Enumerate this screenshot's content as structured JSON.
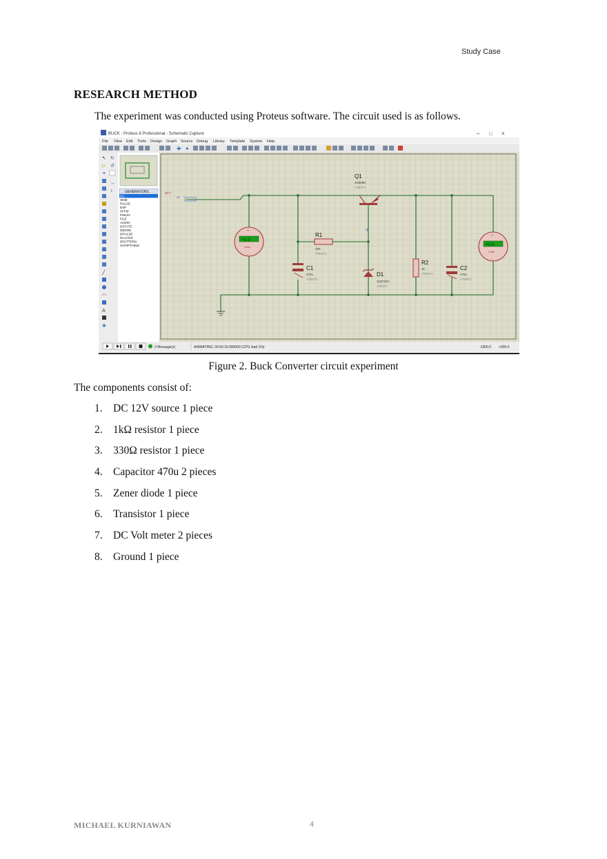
{
  "header": {
    "running_title": "Study Case"
  },
  "section": {
    "heading": "RESEARCH METHOD",
    "intro": "The experiment was conducted using Proteus software. The circuit used is as follows."
  },
  "figure": {
    "caption": "Figure 2. Buck Converter circuit experiment",
    "screenshot": {
      "window_title": "BUCK - Proteus 8 Professional - Schematic Capture",
      "menu": [
        "File",
        "View",
        "Edit",
        "Tools",
        "Design",
        "Graph",
        "Source",
        "Debug",
        "Library",
        "Template",
        "System",
        "Help"
      ],
      "panel_title": "GENERATORS",
      "generators": [
        "DC",
        "SINE",
        "PULSE",
        "EXP",
        "SFFM",
        "PWLIN",
        "FILE",
        "AUDIO",
        "DSTATE",
        "DEDGE",
        "DPULSE",
        "DCLOCK",
        "DPATTERN",
        "SCRIPTABLE"
      ],
      "status_messages": "2 Message(s)",
      "status_animation": "ANIMATING: 00:00:19.900000 (CPU load 1%)",
      "status_coords": [
        "-1900.0",
        "+900.0"
      ],
      "components": {
        "q1": {
          "name": "Q1",
          "part": "2N3055",
          "text": "<TEXT>"
        },
        "r1": {
          "name": "R1",
          "value": "330",
          "text": "<TEXT>"
        },
        "c1": {
          "name": "C1",
          "value": "470u",
          "text": "<TEXT>"
        },
        "d1": {
          "name": "D1",
          "part": "1N4733A",
          "text": "<TEXT>"
        },
        "r2": {
          "name": "R2",
          "value": "1k",
          "text": "<TEXT>"
        },
        "c2": {
          "name": "C2",
          "value": "470u",
          "text": "<TEXT>"
        },
        "source": {
          "label": "DC?",
          "value": "12V"
        },
        "volt1": {
          "reading": "+12.0",
          "unit": "Volts"
        },
        "volt2": {
          "reading": "+5.41",
          "unit": "Volts"
        }
      }
    }
  },
  "components": {
    "heading": "The components consist of:",
    "items": [
      "DC 12V source 1 piece",
      "1kΩ resistor 1 piece",
      "330Ω resistor 1 piece",
      "Capacitor 470u 2 pieces",
      "Zener diode 1 piece",
      "Transistor 1 piece",
      "DC Volt meter 2 pieces",
      "Ground 1 piece"
    ]
  },
  "footer": {
    "author": "MICHAEL KURNIAWAN",
    "page_number": "4"
  },
  "colors": {
    "schematic_bg": "#dcdcc8",
    "wire": "#1f6b2a",
    "component": "#a03a3a",
    "meter_display": "#1aa01a",
    "selection": "#1c6ed6"
  }
}
